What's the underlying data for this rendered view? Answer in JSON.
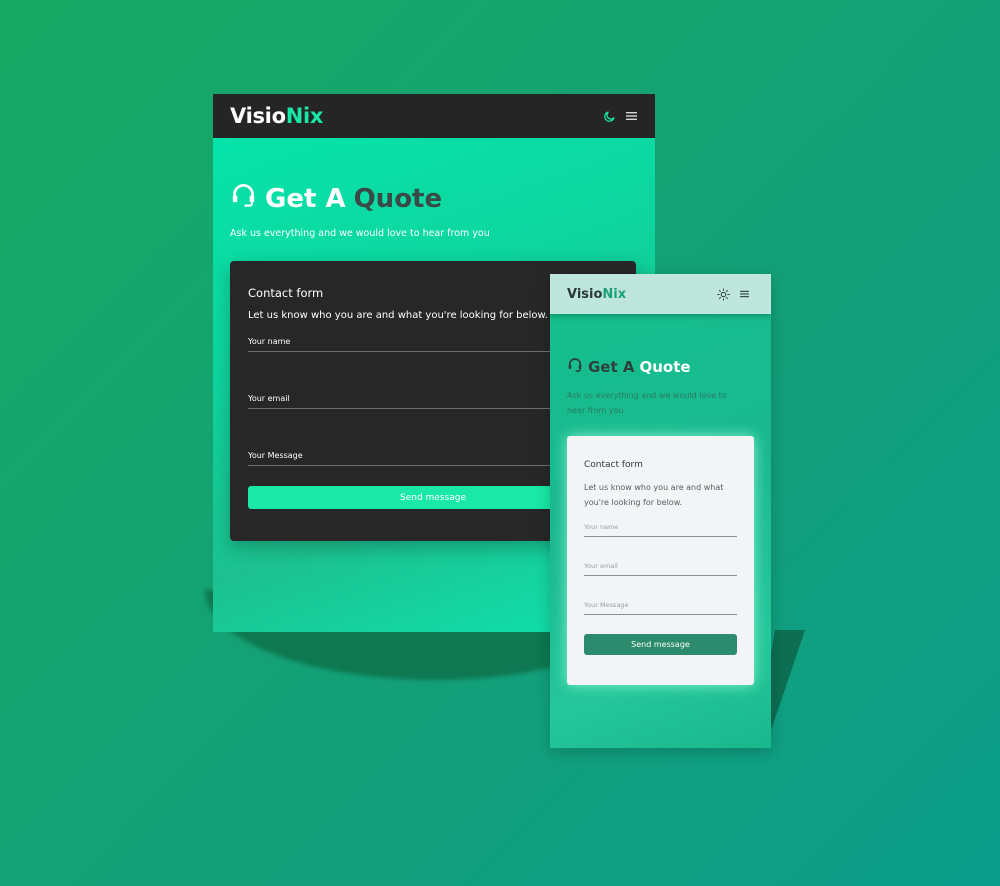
{
  "desktop": {
    "brand": {
      "part1": "Visio",
      "part2": "Nix"
    },
    "title": {
      "part1": "Get A",
      "part2": "Quote"
    },
    "subtitle": "Ask us everything and we would love to hear from you",
    "form": {
      "title": "Contact form",
      "subtitle": "Let us know who you are and what you're looking for below.",
      "name_placeholder": "Your name",
      "email_placeholder": "Your email",
      "message_placeholder": "Your Message",
      "submit_label": "Send message"
    }
  },
  "mobile": {
    "brand": {
      "part1": "Visio",
      "part2": "Nix"
    },
    "title": {
      "part1": "Get A",
      "part2": "Quote"
    },
    "subtitle": "Ask us everything and we would love to hear from you",
    "form": {
      "title": "Contact form",
      "subtitle": "Let us know who you are and what you're looking for below.",
      "name_placeholder": "Your name",
      "email_placeholder": "Your email",
      "message_placeholder": "Your Message",
      "submit_label": "Send message"
    }
  },
  "icons": {
    "theme_toggle_dark": "moon-icon",
    "theme_toggle_light": "sun-icon",
    "menu": "hamburger-menu-icon",
    "title": "headset-icon"
  },
  "colors": {
    "accent": "#19e7a7",
    "dark_nav": "#252526",
    "dark_card": "#272727",
    "light_nav": "#bfe6dc",
    "light_card": "#f2f4f5",
    "mobile_button": "#2b8b6c"
  }
}
